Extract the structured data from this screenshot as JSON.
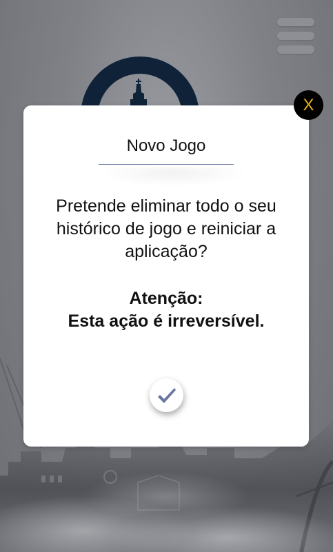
{
  "colors": {
    "logo_ring": "#0f2238",
    "close_text": "#e8b020",
    "check": "#6b76a0",
    "divider": "#6b76a0"
  },
  "header": {
    "menu_icon": "hamburger-menu-icon"
  },
  "logo": {
    "icon": "tower-icon"
  },
  "dialog": {
    "title": "Novo Jogo",
    "message": "Pretende eliminar todo o seu histórico de jogo e reiniciar a aplicação?",
    "warning_line1": "Atenção:",
    "warning_line2": "Esta ação é irreversível.",
    "close_label": "X",
    "confirm_icon": "checkmark-icon"
  }
}
